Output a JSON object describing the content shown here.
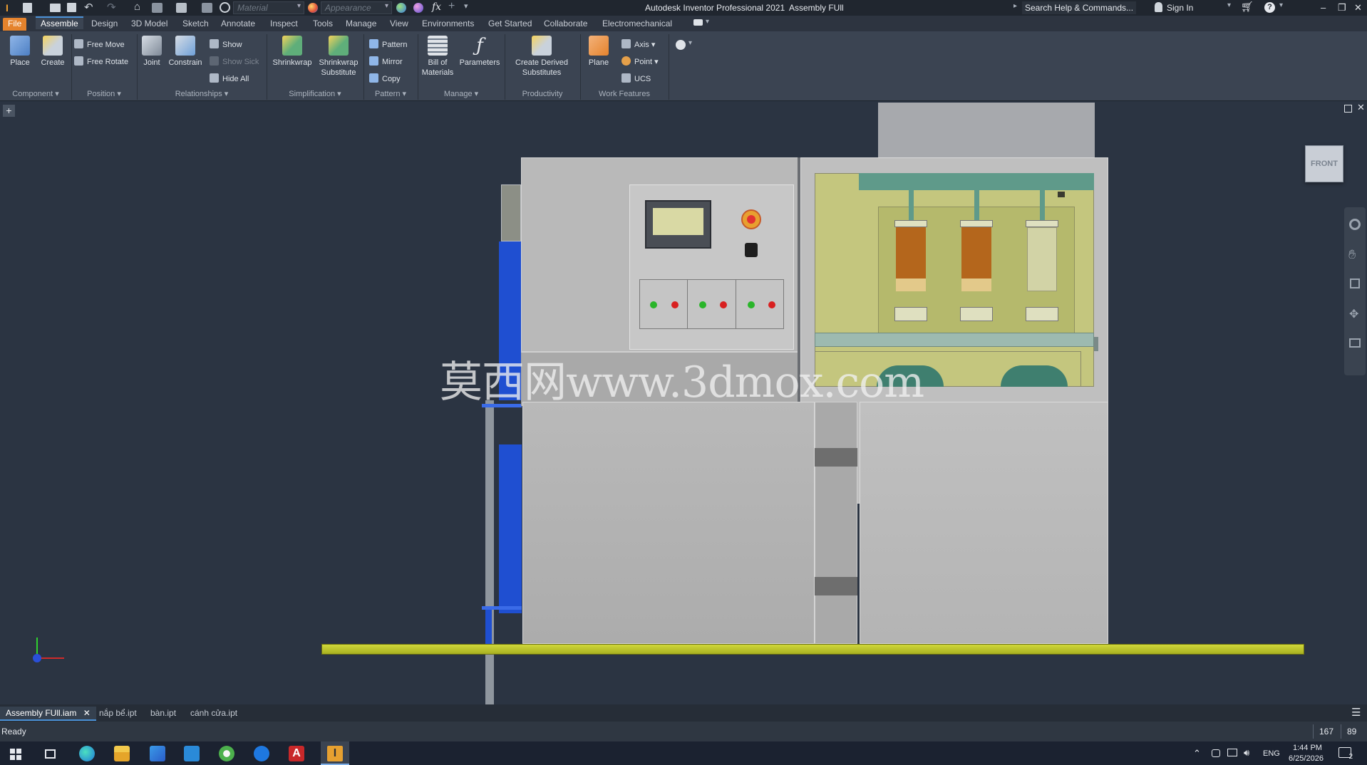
{
  "titlebar": {
    "app_title": "Autodesk Inventor Professional 2021",
    "doc_title": "Assembly FUll",
    "material_placeholder": "Material",
    "appearance_placeholder": "Appearance",
    "fx_label": "fx",
    "search_placeholder": "Search Help & Commands...",
    "sign_in": "Sign In"
  },
  "ribbon_tabs": [
    {
      "label": "File"
    },
    {
      "label": "Assemble"
    },
    {
      "label": "Design"
    },
    {
      "label": "3D Model"
    },
    {
      "label": "Sketch"
    },
    {
      "label": "Annotate"
    },
    {
      "label": "Inspect"
    },
    {
      "label": "Tools"
    },
    {
      "label": "Manage"
    },
    {
      "label": "View"
    },
    {
      "label": "Environments"
    },
    {
      "label": "Get Started"
    },
    {
      "label": "Collaborate"
    },
    {
      "label": "Electromechanical"
    }
  ],
  "ribbon": {
    "place": "Place",
    "create": "Create",
    "free_move": "Free Move",
    "free_rotate": "Free Rotate",
    "joint": "Joint",
    "constrain": "Constrain",
    "show": "Show",
    "show_sick": "Show Sick",
    "hide_all": "Hide All",
    "shrinkwrap": "Shrinkwrap",
    "shrinkwrap_sub_1": "Shrinkwrap",
    "shrinkwrap_sub_2": "Substitute",
    "pattern": "Pattern",
    "mirror": "Mirror",
    "copy": "Copy",
    "bom_1": "Bill of",
    "bom_2": "Materials",
    "parameters": "Parameters",
    "cds_1": "Create Derived",
    "cds_2": "Substitutes",
    "plane": "Plane",
    "axis": "Axis",
    "point": "Point",
    "ucs": "UCS",
    "groups": {
      "component": "Component",
      "position": "Position",
      "relationships": "Relationships",
      "simplification": "Simplification",
      "pattern": "Pattern",
      "manage": "Manage",
      "productivity": "Productivity",
      "work_features": "Work Features"
    }
  },
  "viewcube": {
    "face": "FRONT"
  },
  "watermark": "莫西网www.3dmox.com",
  "doc_tabs": [
    {
      "label": "Assembly FUll.iam"
    },
    {
      "label": "nắp bể.ipt"
    },
    {
      "label": "bàn.ipt"
    },
    {
      "label": "cánh cửa.ipt"
    }
  ],
  "status": {
    "text": "Ready",
    "count_a": "167",
    "count_b": "89"
  },
  "tray": {
    "lang": "ENG",
    "time": "1:44 PM",
    "date": "6/25/2026",
    "notif": "2"
  },
  "colors": {
    "accent_file": "#e5832d",
    "machine_gray": "#b8b8b8",
    "floor_yellow": "#c8d030",
    "blue_frame": "#1f4fd1",
    "green_led": "#2ab52a",
    "red_led": "#d82020"
  }
}
